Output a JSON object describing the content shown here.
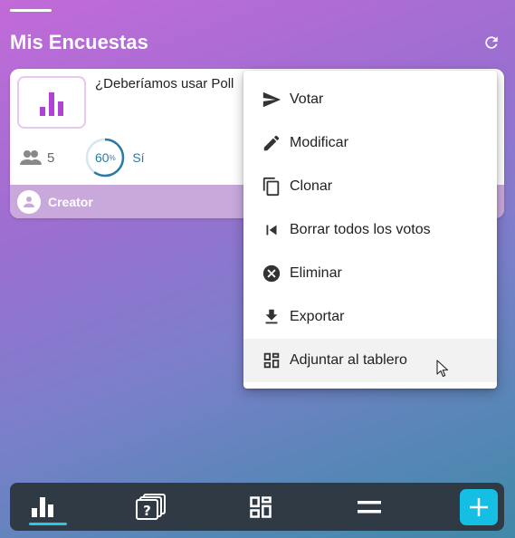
{
  "header": {
    "title": "Mis Encuestas",
    "refresh_icon": "refresh-icon"
  },
  "poll_card": {
    "title": "¿Deberíamos usar Poll",
    "thumbnail_icon": "bar-chart-icon",
    "voters_count": "5",
    "result_percent": "60",
    "result_percent_sign": "%",
    "result_answer": "Sí",
    "creator_name": "Creator",
    "colors": {
      "thumbnail_accent": "#b142d6",
      "result": "#2c7aa3",
      "creator_bar": "#c9a9dc"
    }
  },
  "context_menu": {
    "items": [
      {
        "label": "Votar",
        "icon": "send-icon"
      },
      {
        "label": "Modificar",
        "icon": "pencil-icon"
      },
      {
        "label": "Clonar",
        "icon": "copy-icon"
      },
      {
        "label": "Borrar todos los votos",
        "icon": "skip-previous-icon"
      },
      {
        "label": "Eliminar",
        "icon": "cancel-circle-icon"
      },
      {
        "label": "Exportar",
        "icon": "download-icon"
      },
      {
        "label": "Adjuntar al tablero",
        "icon": "dashboard-icon",
        "hovered": true
      }
    ]
  },
  "bottom_nav": {
    "items": [
      {
        "icon": "bar-chart-icon",
        "active": true
      },
      {
        "icon": "questions-icon",
        "active": false
      },
      {
        "icon": "dashboard-icon",
        "active": false
      },
      {
        "icon": "menu-icon",
        "active": false
      }
    ],
    "add_icon": "plus-icon",
    "colors": {
      "background": "#2f3a44",
      "accent": "#15bfe3"
    }
  }
}
